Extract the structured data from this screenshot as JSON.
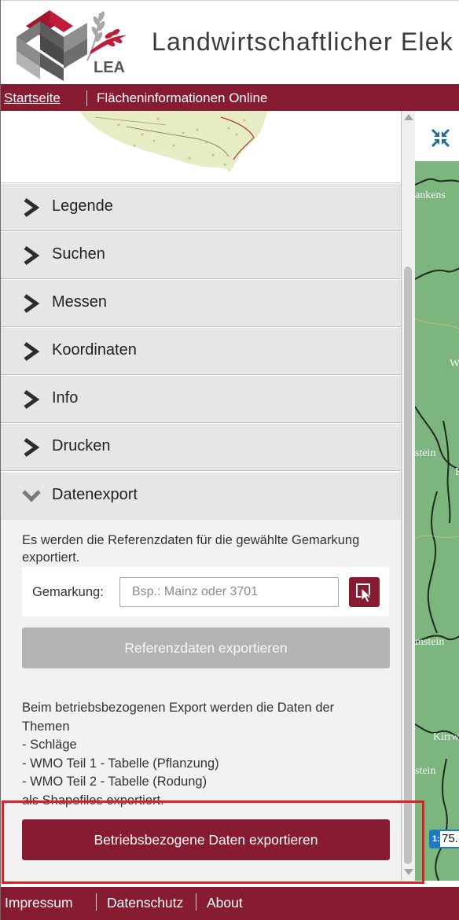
{
  "header": {
    "logo_text": "LEA",
    "site_title": "Landwirtschaftlicher Elek"
  },
  "nav": {
    "home": "Startseite",
    "current": "Flächeninformationen Online"
  },
  "accordion": [
    {
      "label": "Legende",
      "icon": "chevron-right-icon"
    },
    {
      "label": "Suchen",
      "icon": "chevron-right-icon"
    },
    {
      "label": "Messen",
      "icon": "chevron-right-icon"
    },
    {
      "label": "Koordinaten",
      "icon": "chevron-right-icon"
    },
    {
      "label": "Info",
      "icon": "chevron-right-icon"
    },
    {
      "label": "Drucken",
      "icon": "chevron-right-icon"
    },
    {
      "label": "Datenexport",
      "icon": "chevron-down-icon",
      "expanded": true
    }
  ],
  "datenexport": {
    "description": "Es werden die Referenzdaten für die gewählte Gemarkung exportiert.",
    "gemarkung_label": "Gemarkung:",
    "gemarkung_placeholder": "Bsp.: Mainz oder 3701",
    "gemarkung_value": "",
    "ref_button": "Referenzdaten exportieren",
    "betrieb_text": "Beim betriebsbezogenen Export werden die Daten der Themen\n- Schläge\n- WMO Teil 1 - Tabelle (Pflanzung)\n- WMO Teil 2 - Tabelle (Rodung)\nals Shapefiles exportiert.",
    "betrieb_button": "Betriebsbezogene Daten exportieren"
  },
  "map": {
    "labels": [
      "ankens",
      "W",
      "stein",
      "B",
      "mstein",
      "Kirrw",
      "stein"
    ],
    "scale_prefix": "1:",
    "scale_value": "75."
  },
  "footer": {
    "links": [
      "Impressum",
      "Datenschutz",
      "About"
    ]
  },
  "colors": {
    "brand": "#861b31",
    "map_green": "#7db57f",
    "scale_blue": "#1d7cbf",
    "disabled_button": "#b3b3b3",
    "highlight": "#e02020"
  }
}
